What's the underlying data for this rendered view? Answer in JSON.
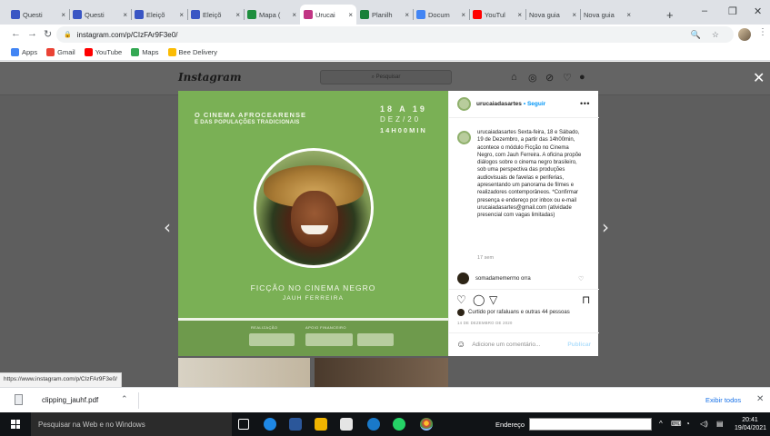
{
  "browser": {
    "tabs": [
      {
        "label": "Questi",
        "fav": "#3a56c4"
      },
      {
        "label": "Questi",
        "fav": "#3a56c4"
      },
      {
        "label": "Eleiçõ",
        "fav": "#3a56c4"
      },
      {
        "label": "Eleiçõ",
        "fav": "#3a56c4"
      },
      {
        "label": "Mapa (",
        "fav": "#1e8e3e"
      },
      {
        "label": "Urucai",
        "fav": "#c13584"
      },
      {
        "label": "Planilh",
        "fav": "#188038"
      },
      {
        "label": "Docum",
        "fav": "#4285f4"
      },
      {
        "label": "YouTul",
        "fav": "#ff0000"
      },
      {
        "label": "Nova guia",
        "fav": ""
      },
      {
        "label": "Nova guia",
        "fav": ""
      }
    ],
    "close_glyph": "×",
    "new_tab": "+",
    "window_minimize": "–",
    "window_restore": "❐",
    "window_close": "✕",
    "url": "instagram.com/p/CIzFAr9F3e0/",
    "bookmarks": [
      {
        "label": "Apps",
        "color": "#4285f4"
      },
      {
        "label": "Gmail",
        "color": "#ea4335"
      },
      {
        "label": "YouTube",
        "color": "#ff0000"
      },
      {
        "label": "Maps",
        "color": "#34a853"
      },
      {
        "label": "Bee Delivery",
        "color": "#fbbc04"
      }
    ]
  },
  "instagram": {
    "logo": "Instagram",
    "search_placeholder": "⌕ Pesquisar",
    "post_image": {
      "headline_line1": "O CINEMA AFROCEARENSE",
      "headline_line2": "E DAS POPULAÇÕES TRADICIONAIS",
      "date_line1": "18 A 19",
      "date_line2": "DEZ/20",
      "date_line3": "14H00MIN",
      "title": "FICÇÃO NO CINEMA NEGRO",
      "subtitle": "JAUH FERREIRA",
      "band_label_left": "REALIZAÇÃO",
      "band_label_right": "APOIO FINANCEIRO",
      "accent": "#7ab055"
    },
    "account": "urucaiadasartes",
    "follow": "• Seguir",
    "more": "•••",
    "caption": "urucaiadasartes Sexta-feira, 18 e Sábado, 19 de Dezembro, a partir das 14h00min, acontece o módulo Ficção no Cinema Negro, com Jauh Ferreira. A oficina propõe diálogos sobre o cinema negro brasileiro, sob uma perspectiva das produções audiovisuais de favelas e periferias, apresentando um panorama de filmes e realizadores contemporâneos. *Confirmar presença e endereço por inbox ou e-mail urucaiadasartes@gmail.com (atividade presencial com vagas limitadas)",
    "caption_time": "17 sem",
    "comment": "somadamemermo orra",
    "liked_by": "Curtido por rafaluans e outras 44 pessoas",
    "post_date": "14 DE DEZEMBRO DE 2020",
    "add_comment_placeholder": "Adicione um comentário...",
    "publish": "Publicar"
  },
  "status_url": "https://www.instagram.com/p/CIzFAr9F3e0/",
  "downloads": {
    "file": "clipping_jauhf.pdf",
    "show_all": "Exibir todos"
  },
  "taskbar": {
    "search_placeholder": "Pesquisar na Web e no Windows",
    "address_label": "Endereço",
    "time": "20:41",
    "date": "19/04/2021"
  }
}
